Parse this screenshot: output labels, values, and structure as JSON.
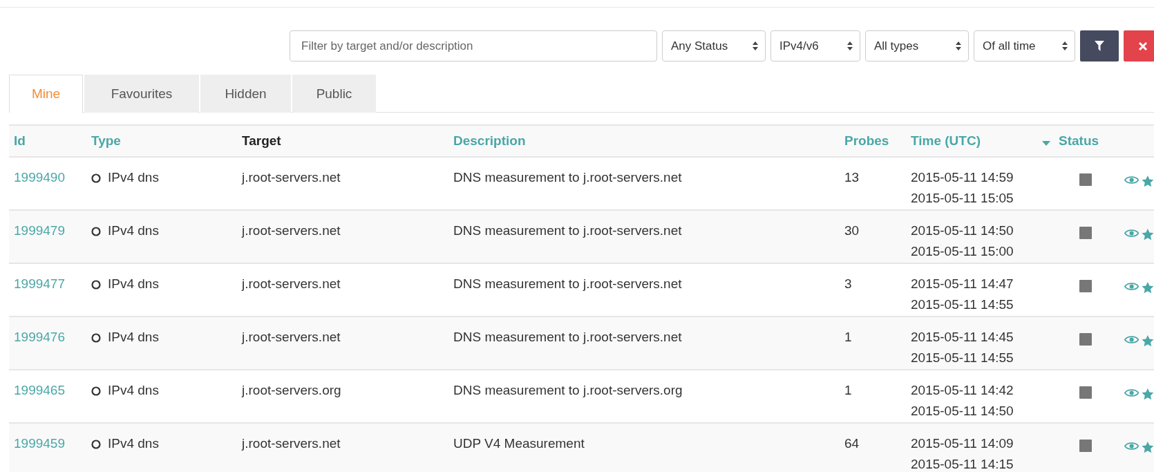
{
  "filters": {
    "search": {
      "placeholder": "Filter by target and/or description"
    },
    "selects": [
      {
        "value": "Any Status"
      },
      {
        "value": "IPv4/v6"
      },
      {
        "value": "All types"
      },
      {
        "value": "Of all time"
      }
    ],
    "buttons": [
      {
        "kind": "filter"
      },
      {
        "kind": "clear"
      }
    ]
  },
  "tabs": [
    {
      "label": "Mine",
      "selected": true
    },
    {
      "label": "Favourites",
      "selected": false
    },
    {
      "label": "Hidden",
      "selected": false
    },
    {
      "label": "Public",
      "selected": false
    }
  ],
  "table": {
    "columns": [
      {
        "label": "Id",
        "sortable": true,
        "sorted": false
      },
      {
        "label": "Type",
        "sortable": true,
        "sorted": false
      },
      {
        "label": "Target",
        "sortable": false,
        "sorted": false
      },
      {
        "label": "Description",
        "sortable": true,
        "sorted": false
      },
      {
        "label": "Probes",
        "sortable": true,
        "sorted": false
      },
      {
        "label": "Time (UTC)",
        "sortable": true,
        "sorted": true
      },
      {
        "label": "Status",
        "sortable": true,
        "sorted": false
      }
    ],
    "rows": [
      {
        "id": "1999490",
        "type": "IPv4 dns",
        "target": "j.root-servers.net",
        "description": "DNS measurement to j.root-servers.net",
        "probes": "13",
        "start": "2015-05-11 14:59",
        "stop": "2015-05-11 15:05"
      },
      {
        "id": "1999479",
        "type": "IPv4 dns",
        "target": "j.root-servers.net",
        "description": "DNS measurement to j.root-servers.net",
        "probes": "30",
        "start": "2015-05-11 14:50",
        "stop": "2015-05-11 15:00"
      },
      {
        "id": "1999477",
        "type": "IPv4 dns",
        "target": "j.root-servers.net",
        "description": "DNS measurement to j.root-servers.net",
        "probes": "3",
        "start": "2015-05-11 14:47",
        "stop": "2015-05-11 14:55"
      },
      {
        "id": "1999476",
        "type": "IPv4 dns",
        "target": "j.root-servers.net",
        "description": "DNS measurement to j.root-servers.net",
        "probes": "1",
        "start": "2015-05-11 14:45",
        "stop": "2015-05-11 14:55"
      },
      {
        "id": "1999465",
        "type": "IPv4 dns",
        "target": "j.root-servers.org",
        "description": "DNS measurement to j.root-servers.org",
        "probes": "1",
        "start": "2015-05-11 14:42",
        "stop": "2015-05-11 14:50"
      },
      {
        "id": "1999459",
        "type": "IPv4 dns",
        "target": "j.root-servers.net",
        "description": "UDP V4 Measurement",
        "probes": "64",
        "start": "2015-05-11 14:09",
        "stop": "2015-05-11 14:15"
      }
    ]
  }
}
